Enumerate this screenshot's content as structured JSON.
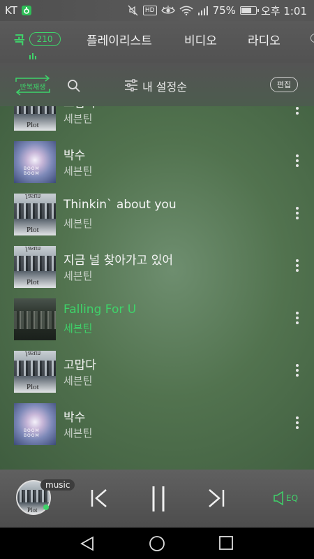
{
  "status": {
    "carrier": "KT",
    "battery": "75%",
    "battery_level": 0.75,
    "time": "오후 1:01",
    "hd": "HD",
    "icons": [
      "carrier-app-icon",
      "mute-icon",
      "hd-icon",
      "eye-icon",
      "wifi-icon",
      "signal-icon",
      "battery-icon"
    ]
  },
  "tabs": {
    "song_label": "곡",
    "song_count": "210",
    "playlist_label": "플레이리스트",
    "video_label": "비디오",
    "radio_label": "라디오"
  },
  "toolbar": {
    "repeat_label": "반복재생",
    "sort_label": "내 설정순",
    "edit_label": "편집"
  },
  "songs": [
    {
      "title": "고맙다",
      "artist": "세븐틴",
      "art": "plot",
      "active": false
    },
    {
      "title": "박수",
      "artist": "세븐틴",
      "art": "galaxy",
      "active": false
    },
    {
      "title": "Thinkin` about you",
      "artist": "세븐틴",
      "art": "plot",
      "active": false
    },
    {
      "title": "지금 널 찾아가고 있어",
      "artist": "세븐틴",
      "art": "plot",
      "active": false
    },
    {
      "title": "Falling For U",
      "artist": "세븐틴",
      "art": "dark",
      "active": true
    },
    {
      "title": "고맙다",
      "artist": "세븐틴",
      "art": "plot",
      "active": false
    },
    {
      "title": "박수",
      "artist": "세븐틴",
      "art": "galaxy",
      "active": false
    }
  ],
  "album_text": {
    "plot": "Plot",
    "plot_top": "Jasun",
    "galaxy": "BOOM BOOM"
  },
  "player": {
    "badge": "music",
    "eq_label": "EQ"
  },
  "colors": {
    "accent": "#3fd36a"
  }
}
